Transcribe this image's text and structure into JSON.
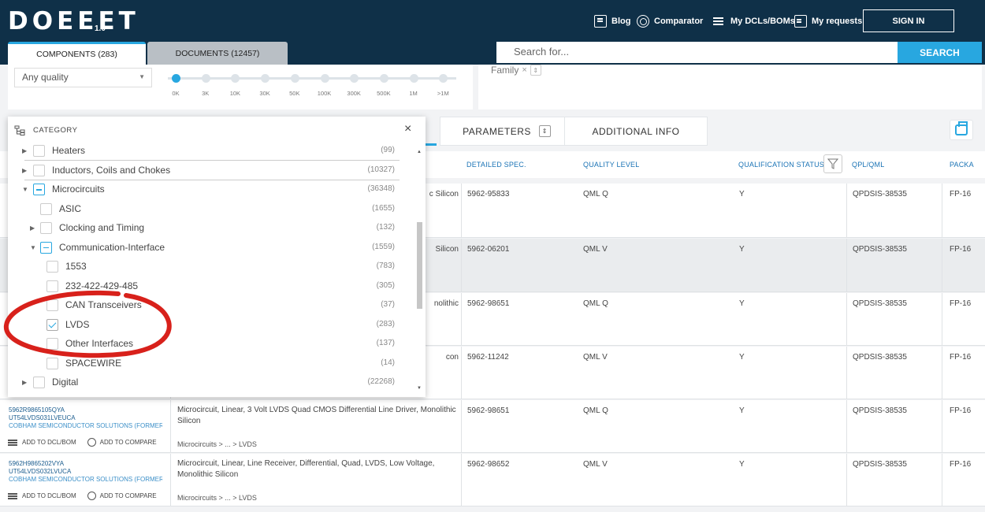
{
  "header": {
    "logo": "DOEEET",
    "version": "1.0",
    "nav": [
      {
        "label": "Blog",
        "icon": "blog-icon"
      },
      {
        "label": "Comparator",
        "icon": "comparator-icon"
      },
      {
        "label": "My DCLs/BOMs",
        "icon": "list-icon"
      },
      {
        "label": "My requests",
        "icon": "document-icon"
      }
    ],
    "sign_in": "SIGN IN"
  },
  "tabs": {
    "components": "COMPONENTS (283)",
    "documents": "DOCUMENTS (12457)"
  },
  "search": {
    "placeholder": "Search for...",
    "button": "SEARCH"
  },
  "filters": {
    "quality_value": "Any quality",
    "quantity_steps": [
      "0K",
      "3K",
      "10K",
      "30K",
      "50K",
      "100K",
      "300K",
      "500K",
      "1M",
      ">1M"
    ],
    "quantity_selected_index": 0,
    "family_tag": "Family"
  },
  "section_tabs": {
    "parameters": "PARAMETERS",
    "additional_info": "ADDITIONAL INFO"
  },
  "table": {
    "columns": {
      "detailed_spec": "DETAILED SPEC.",
      "quality_level": "QUALITY LEVEL",
      "qualification_status": "QUALIFICATION STATUS",
      "qpl_qml": "QPL/QML",
      "package": "PACKA"
    },
    "rows": [
      {
        "desc_tail": "c Silicon",
        "spec": "5962-95833",
        "quality": "QML Q",
        "status": "Y",
        "qpl": "QPDSIS-38535",
        "pkg": "FP-16"
      },
      {
        "desc_tail": "Silicon",
        "spec": "5962-06201",
        "quality": "QML V",
        "status": "Y",
        "qpl": "QPDSIS-38535",
        "pkg": "FP-16"
      },
      {
        "desc_tail": "nolithic",
        "spec": "5962-98651",
        "quality": "QML Q",
        "status": "Y",
        "qpl": "QPDSIS-38535",
        "pkg": "FP-16"
      },
      {
        "desc_tail": "con",
        "spec": "5962-11242",
        "quality": "QML V",
        "status": "Y",
        "qpl": "QPDSIS-38535",
        "pkg": "FP-16"
      },
      {
        "pn1": "5962R9865105QYA",
        "pn2": "UT54LVDS031LVEUCA",
        "manufacturer": "COBHAM SEMICONDUCTOR SOLUTIONS (FORMERL...",
        "add_dcl": "ADD TO DCL/BOM",
        "add_compare": "ADD TO COMPARE",
        "desc": "Microcircuit, Linear, 3 Volt LVDS Quad CMOS Differential Line Driver, Monolithic Silicon",
        "breadcrumb": "Microcircuits > ... > LVDS",
        "spec": "5962-98651",
        "quality": "QML Q",
        "status": "Y",
        "qpl": "QPDSIS-38535",
        "pkg": "FP-16"
      },
      {
        "pn1": "5962H9865202VYA",
        "pn2": "UT54LVDS032LVUCA",
        "manufacturer": "COBHAM SEMICONDUCTOR SOLUTIONS (FORMERL...",
        "add_dcl": "ADD TO DCL/BOM",
        "add_compare": "ADD TO COMPARE",
        "desc": "Microcircuit, Linear, Line Receiver, Differential, Quad, LVDS, Low Voltage, Monolithic Silicon",
        "breadcrumb": "Microcircuits > ... > LVDS",
        "spec": "5962-98652",
        "quality": "QML V",
        "status": "Y",
        "qpl": "QPDSIS-38535",
        "pkg": "FP-16"
      }
    ]
  },
  "category_popup": {
    "title": "CATEGORY",
    "close": "×",
    "items": [
      {
        "label": "Heaters",
        "count": "(99)",
        "level": 0,
        "state": "collapsed",
        "check": "none"
      },
      {
        "label": "Inductors, Coils and Chokes",
        "count": "(10327)",
        "level": 0,
        "state": "collapsed",
        "check": "none"
      },
      {
        "label": "Microcircuits",
        "count": "(36348)",
        "level": 0,
        "state": "expanded",
        "check": "partial"
      },
      {
        "label": "ASIC",
        "count": "(1655)",
        "level": 1,
        "state": "leaf",
        "check": "none"
      },
      {
        "label": "Clocking and Timing",
        "count": "(132)",
        "level": 1,
        "state": "collapsed",
        "check": "none"
      },
      {
        "label": "Communication-Interface",
        "count": "(1559)",
        "level": 1,
        "state": "expanded",
        "check": "partial"
      },
      {
        "label": "1553",
        "count": "(783)",
        "level": 2,
        "state": "leaf",
        "check": "none"
      },
      {
        "label": "232-422-429-485",
        "count": "(305)",
        "level": 2,
        "state": "leaf",
        "check": "none"
      },
      {
        "label": "CAN Transceivers",
        "count": "(37)",
        "level": 2,
        "state": "leaf",
        "check": "none"
      },
      {
        "label": "LVDS",
        "count": "(283)",
        "level": 2,
        "state": "leaf",
        "check": "checked"
      },
      {
        "label": "Other Interfaces",
        "count": "(137)",
        "level": 2,
        "state": "leaf",
        "check": "none"
      },
      {
        "label": "SPACEWIRE",
        "count": "(14)",
        "level": 2,
        "state": "leaf",
        "check": "none"
      },
      {
        "label": "Digital",
        "count": "(22268)",
        "level": 0,
        "state": "collapsed",
        "check": "none"
      }
    ]
  },
  "colors": {
    "header_bg": "#0f3048",
    "accent": "#28a7e0",
    "annotation": "#d8211b"
  }
}
